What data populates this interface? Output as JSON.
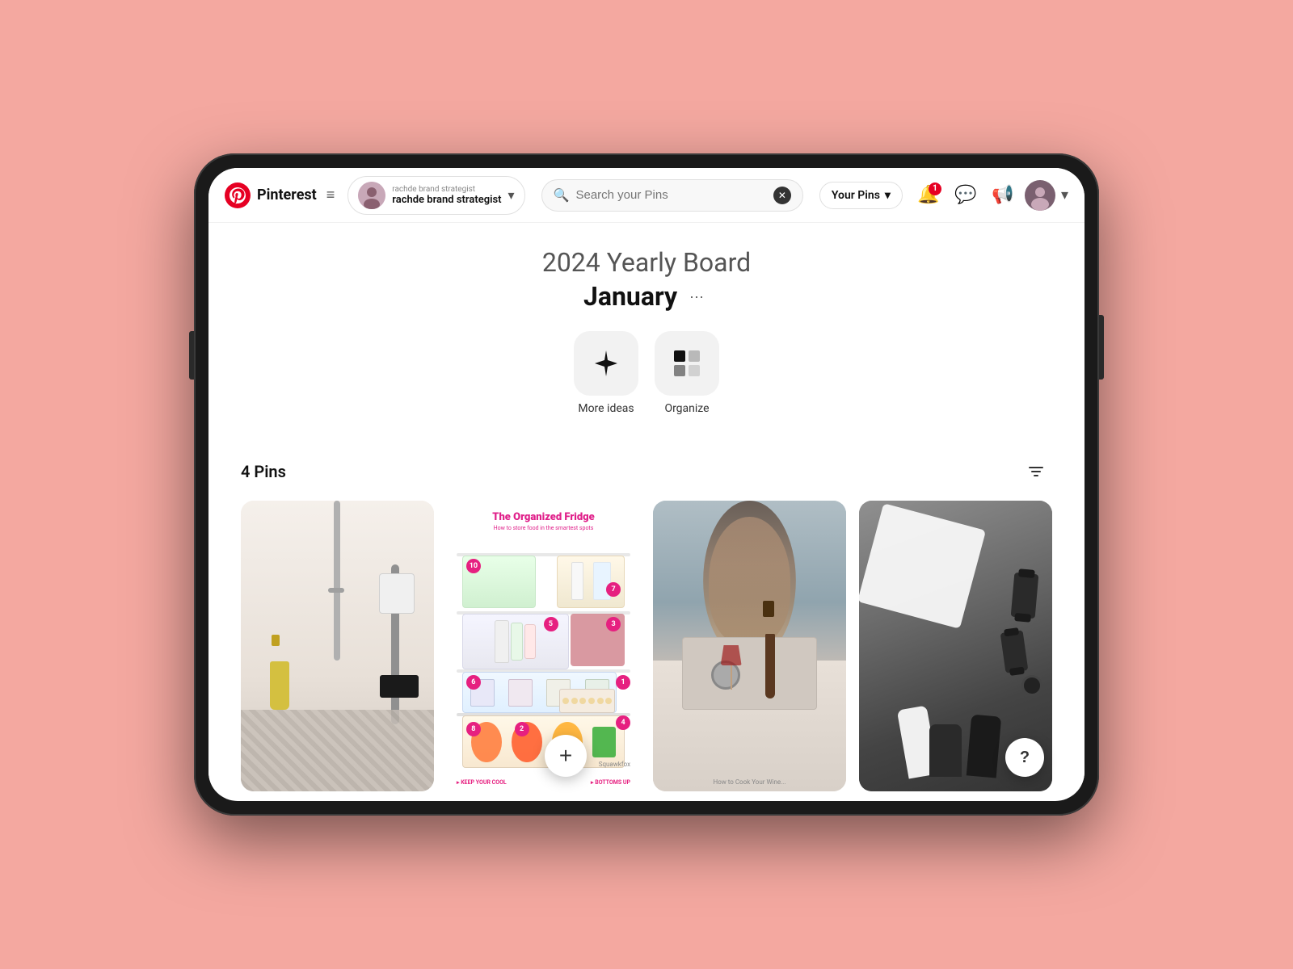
{
  "device": {
    "background_color": "#f4a8a0"
  },
  "navbar": {
    "brand_name": "Pinterest",
    "hamburger_label": "≡",
    "account_subtitle": "rachde brand strategist",
    "account_name": "rachde brand strategist",
    "search_placeholder": "Search your Pins",
    "search_clear_label": "✕",
    "search_scope_label": "Your Pins",
    "chevron_label": "▾",
    "notification_count": "1",
    "notification_icon": "🔔",
    "messages_icon": "💬",
    "announcements_icon": "📢",
    "more_icon": "▾"
  },
  "board": {
    "title": "2024 Yearly Board",
    "section_title": "January",
    "more_options_label": "···",
    "actions": [
      {
        "id": "more-ideas",
        "icon": "✦",
        "label": "More ideas"
      },
      {
        "id": "organize",
        "icon": "⊞",
        "label": "Organize"
      }
    ]
  },
  "pins": {
    "count_label": "4 Pins",
    "add_label": "+",
    "help_label": "?",
    "filter_icon": "⚙"
  }
}
